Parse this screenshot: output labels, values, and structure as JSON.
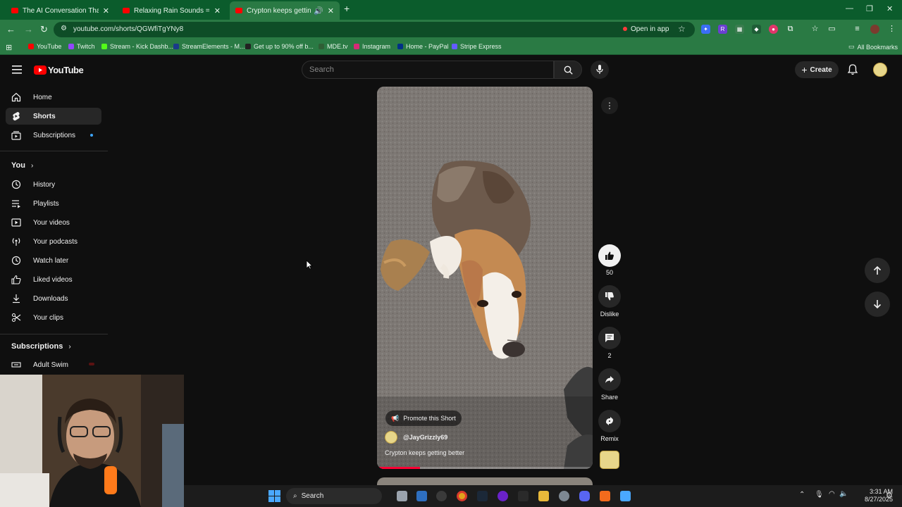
{
  "browser": {
    "tabs": [
      {
        "title": "The AI Conversation That Left N"
      },
      {
        "title": "Relaxing Rain Sounds = Drifting"
      },
      {
        "title": "Crypton keeps getting bett"
      }
    ],
    "url": "youtube.com/shorts/QGWfiTgYNy8",
    "open_in_app": "Open in app",
    "bookmarks": [
      "YouTube",
      "Twitch",
      "Stream - Kick Dashb...",
      "StreamElements - M...",
      "Get up to 90% off b...",
      "MDE.tv",
      "Instagram",
      "Home - PayPal",
      "Stripe Express"
    ],
    "all_bookmarks": "All Bookmarks",
    "extension_badge": "R"
  },
  "header": {
    "logo_text": "YouTube",
    "search_placeholder": "Search",
    "create_label": "Create"
  },
  "sidebar": {
    "primary": [
      {
        "label": "Home",
        "icon": "home-icon"
      },
      {
        "label": "Shorts",
        "icon": "shorts-icon"
      },
      {
        "label": "Subscriptions",
        "icon": "subscriptions-icon"
      }
    ],
    "you_heading": "You",
    "you_items": [
      {
        "label": "History",
        "icon": "history-icon"
      },
      {
        "label": "Playlists",
        "icon": "playlists-icon"
      },
      {
        "label": "Your videos",
        "icon": "your-videos-icon"
      },
      {
        "label": "Your podcasts",
        "icon": "podcasts-icon"
      },
      {
        "label": "Watch later",
        "icon": "watch-later-icon"
      },
      {
        "label": "Liked videos",
        "icon": "like-icon"
      },
      {
        "label": "Downloads",
        "icon": "download-icon"
      },
      {
        "label": "Your clips",
        "icon": "scissors-icon"
      }
    ],
    "subs_heading": "Subscriptions",
    "subs_items": [
      {
        "label": "Adult Swim",
        "icon": "channel-icon"
      }
    ]
  },
  "short": {
    "promote_label": "Promote this Short",
    "channel": "@JayGrizzly69",
    "title": "Crypton keeps getting better",
    "progress": 0.2
  },
  "actions": {
    "likes": "50",
    "dislike": "Dislike",
    "comments": "2",
    "share": "Share",
    "remix": "Remix"
  },
  "taskbar": {
    "search_label": "Search",
    "time": "3:31 AM",
    "date": "8/27/2025"
  },
  "colors": {
    "chrome_green": "#2a7a44",
    "youtube_red": "#ff0000",
    "page_bg": "#0f0f0f"
  }
}
